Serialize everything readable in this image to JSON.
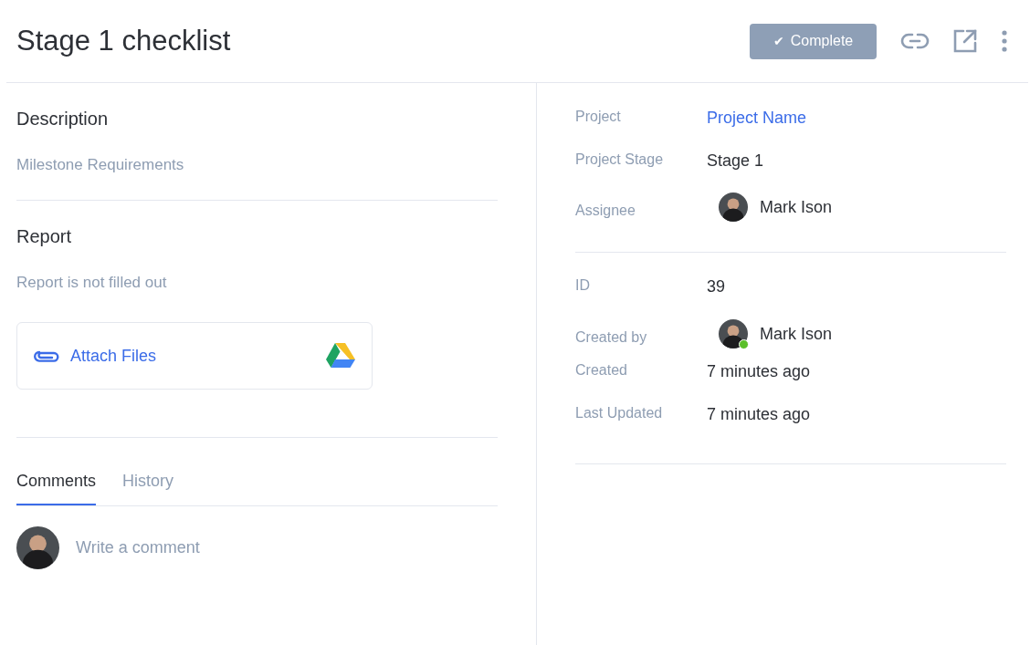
{
  "title": "Stage 1 checklist",
  "complete_button": {
    "label": "Complete",
    "check": "✔"
  },
  "description": {
    "heading": "Description",
    "text": "Milestone Requirements"
  },
  "report": {
    "heading": "Report",
    "text": "Report is not filled out",
    "attach_label": "Attach Files"
  },
  "tabs": [
    {
      "label": "Comments",
      "selected": true
    },
    {
      "label": "History",
      "selected": false
    }
  ],
  "comment": {
    "placeholder": "Write a comment"
  },
  "details": [
    [
      {
        "label": "Project",
        "kind": "link",
        "value": "Project Name"
      },
      {
        "label": "Project Stage",
        "kind": "text",
        "value": "Stage 1"
      },
      {
        "label": "Assignee",
        "kind": "person",
        "value": "Mark Ison",
        "online": false
      }
    ],
    [
      {
        "label": "ID",
        "kind": "text",
        "value": "39"
      },
      {
        "label": "Created by",
        "kind": "person",
        "value": "Mark Ison",
        "online": true
      },
      {
        "label": "Created",
        "kind": "text",
        "value": "7 minutes ago"
      },
      {
        "label": "Last Updated",
        "kind": "text",
        "value": "7 minutes ago"
      }
    ]
  ]
}
